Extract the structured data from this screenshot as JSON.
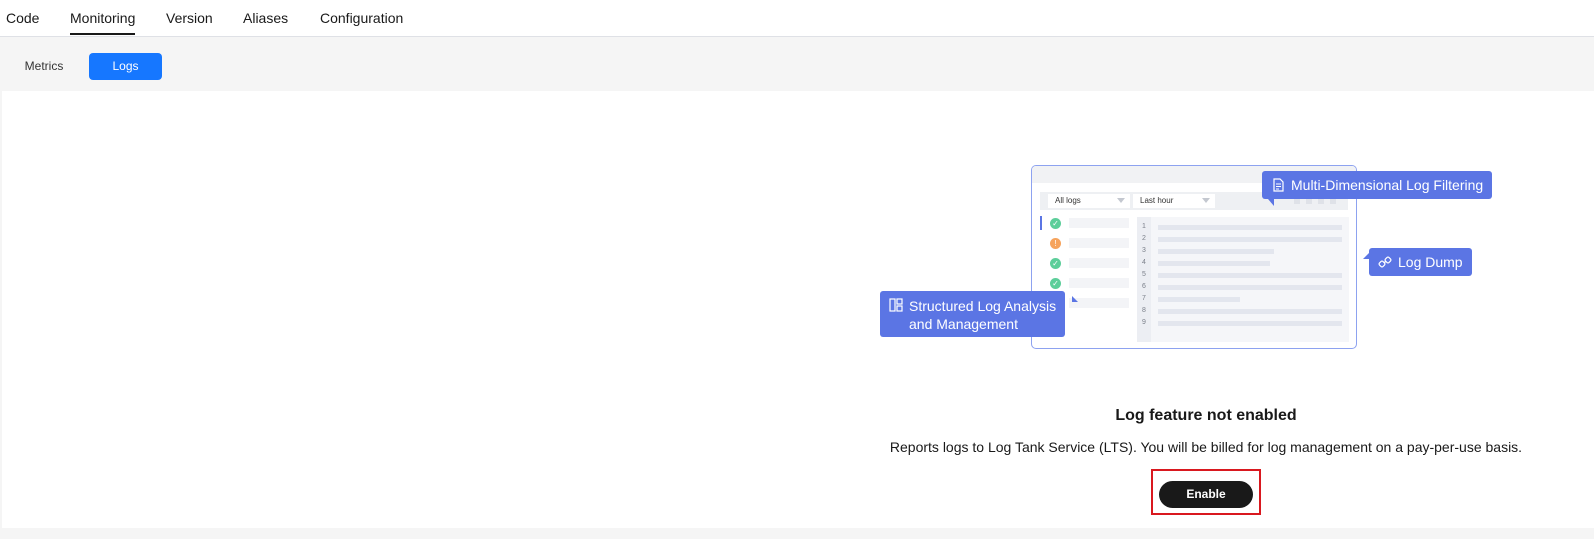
{
  "top_tabs": [
    {
      "label": "Code",
      "active": false
    },
    {
      "label": "Monitoring",
      "active": true
    },
    {
      "label": "Version",
      "active": false
    },
    {
      "label": "Aliases",
      "active": false
    },
    {
      "label": "Configuration",
      "active": false
    }
  ],
  "sub_tabs": [
    {
      "label": "Metrics",
      "active": false
    },
    {
      "label": "Logs",
      "active": true
    }
  ],
  "illustration": {
    "select_all_logs": "All logs",
    "select_time": "Last hour",
    "line_numbers": [
      "1",
      "2",
      "3",
      "4",
      "5",
      "6",
      "7",
      "8",
      "9"
    ],
    "callouts": {
      "filtering": "Multi-Dimensional Log Filtering",
      "dump": "Log Dump",
      "structured_line1": "Structured Log Analysis",
      "structured_line2": "and Management"
    }
  },
  "message": {
    "title": "Log feature not enabled",
    "description": "Reports logs to Log Tank Service (LTS). You will be billed for log management on a pay-per-use basis."
  },
  "enable_button": {
    "label": "Enable"
  },
  "colors": {
    "accent": "#1677ff",
    "callout": "#5b75e4",
    "highlight_frame": "#d9181f",
    "button_dark": "#191919"
  }
}
